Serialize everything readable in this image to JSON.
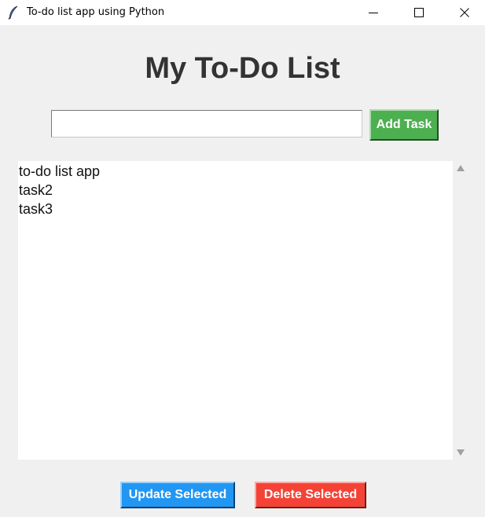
{
  "window": {
    "title": "To-do list app using Python",
    "icon": "feather-icon",
    "controls": [
      "minimize-icon",
      "maximize-icon",
      "close-icon"
    ]
  },
  "main": {
    "heading": "My To-Do List",
    "task_input": {
      "value": "",
      "placeholder": ""
    },
    "add_button_label": "Add Task",
    "tasks": [
      "to-do list app",
      "task2",
      "task3"
    ],
    "update_button_label": "Update Selected",
    "delete_button_label": "Delete Selected"
  },
  "colors": {
    "add_button": "#4caf50",
    "update_button": "#2196f3",
    "delete_button": "#f44336",
    "heading": "#333333",
    "background": "#f0f0f0"
  }
}
